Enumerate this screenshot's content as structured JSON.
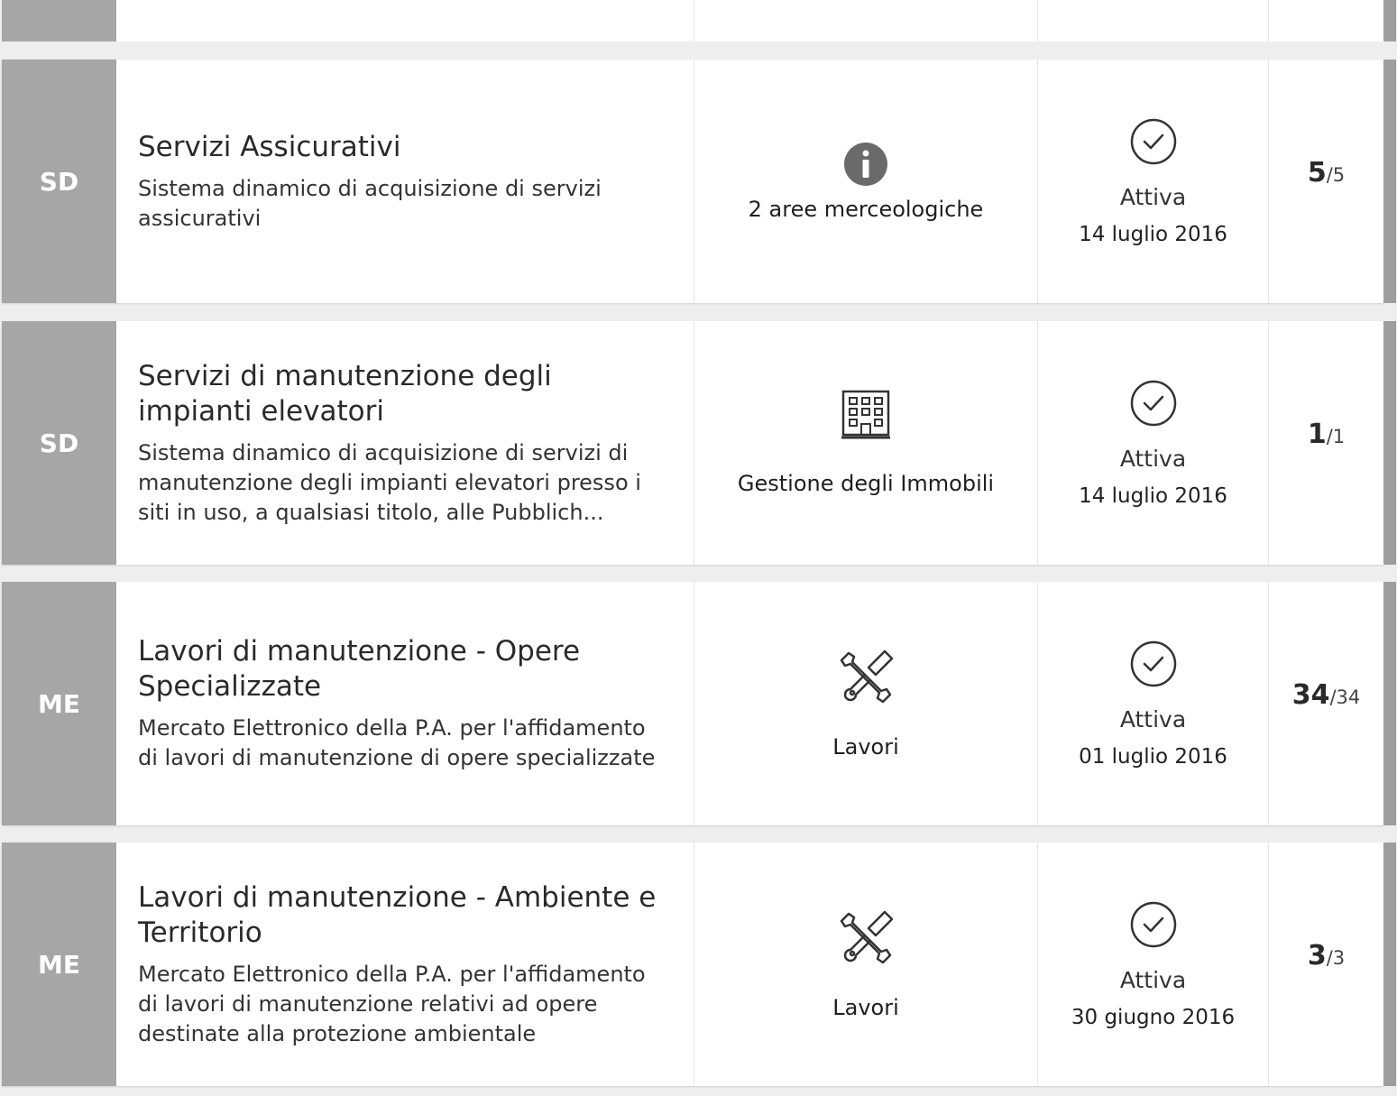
{
  "rows": [
    {
      "badge": "SD",
      "title": "Servizi Assicurativi",
      "description": "Sistema dinamico di acquisizione di servizi assicurativi",
      "category_icon": "info-icon",
      "category": "2 aree merceologiche",
      "status_icon": "check-circle-icon",
      "status": "Attiva",
      "date": "14 luglio 2016",
      "count": "5",
      "total": "/5"
    },
    {
      "badge": "SD",
      "title": "Servizi di manutenzione degli impianti elevatori",
      "description": "Sistema dinamico di acquisizione di servizi di manutenzione degli impianti elevatori presso i siti in uso, a qualsiasi titolo, alle Pubblich...",
      "category_icon": "building-icon",
      "category": "Gestione degli Immobili",
      "status_icon": "check-circle-icon",
      "status": "Attiva",
      "date": "14 luglio 2016",
      "count": "1",
      "total": "/1"
    },
    {
      "badge": "ME",
      "title": "Lavori di manutenzione - Opere Specializzate",
      "description": "Mercato Elettronico della P.A. per l'affidamento di lavori di manutenzione di opere specializzate",
      "category_icon": "tools-icon",
      "category": "Lavori",
      "status_icon": "check-circle-icon",
      "status": "Attiva",
      "date": "01 luglio 2016",
      "count": "34",
      "total": "/34"
    },
    {
      "badge": "ME",
      "title": "Lavori di manutenzione - Ambiente e Territorio",
      "description": "Mercato Elettronico della P.A. per l'affidamento di lavori di manutenzione relativi ad opere destinate alla protezione ambientale",
      "category_icon": "tools-icon",
      "category": "Lavori",
      "status_icon": "check-circle-icon",
      "status": "Attiva",
      "date": "30 giugno 2016",
      "count": "3",
      "total": "/3"
    }
  ],
  "colors": {
    "badge_bg": "#a6a6a6",
    "card_bg": "#ffffff",
    "page_bg": "#eeeeee",
    "icon_dark": "#555555"
  }
}
